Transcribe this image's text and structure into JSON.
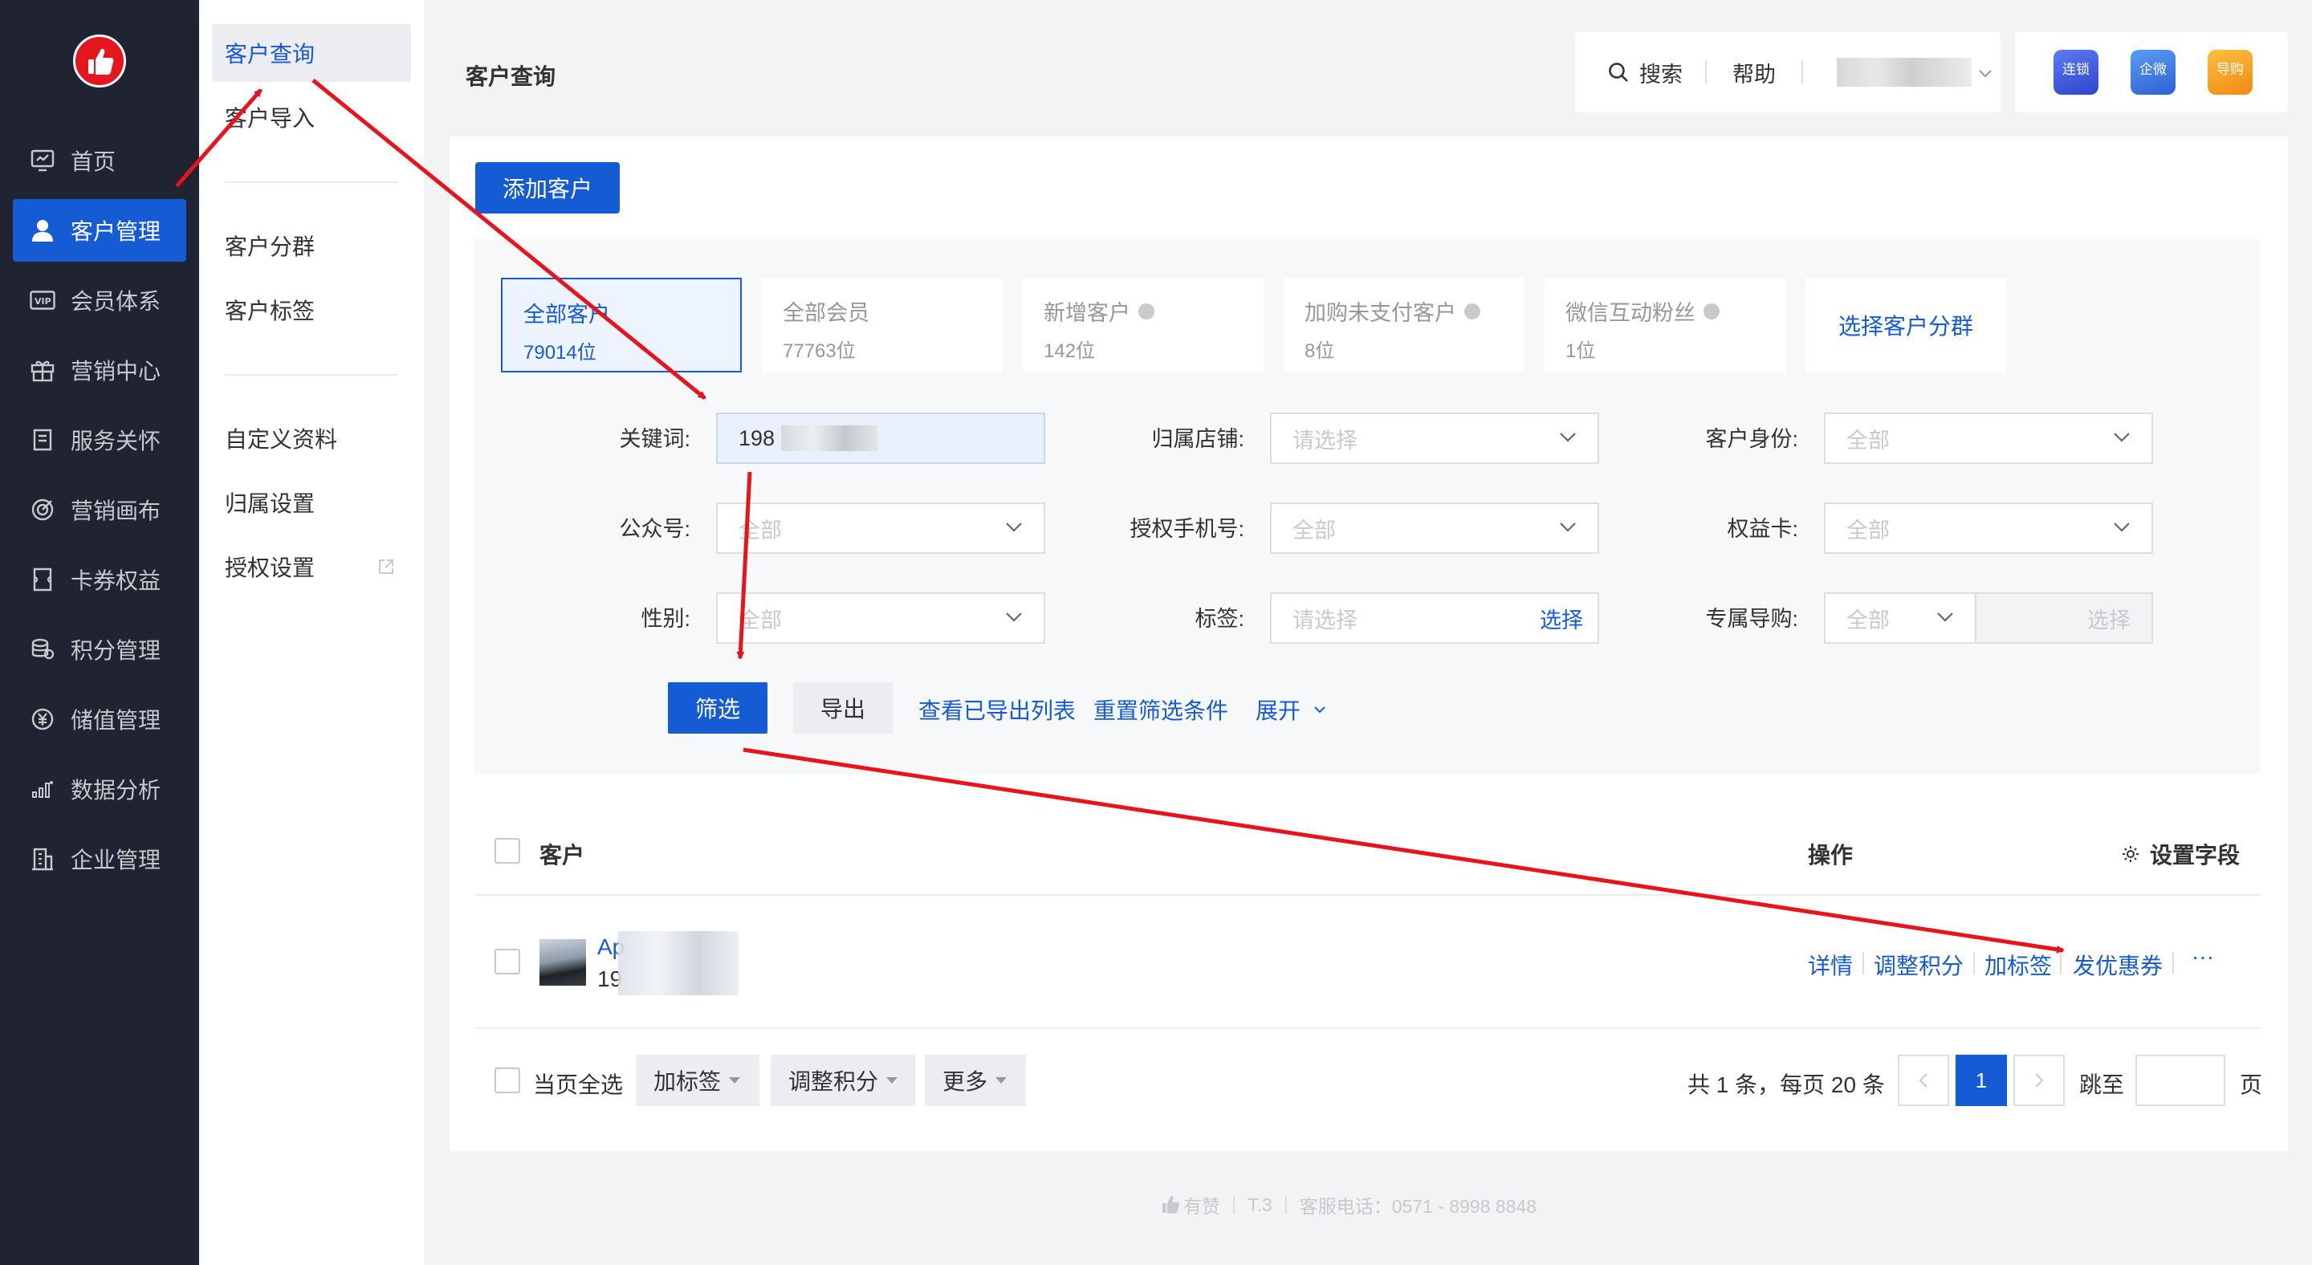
{
  "nav": {
    "items": [
      {
        "label": "首页",
        "icon": "dashboard-icon"
      },
      {
        "label": "客户管理",
        "icon": "user-icon"
      },
      {
        "label": "会员体系",
        "icon": "vip-icon"
      },
      {
        "label": "营销中心",
        "icon": "gift-icon"
      },
      {
        "label": "服务关怀",
        "icon": "book-icon"
      },
      {
        "label": "营销画布",
        "icon": "target-icon"
      },
      {
        "label": "卡券权益",
        "icon": "coupon-icon"
      },
      {
        "label": "积分管理",
        "icon": "coins-icon"
      },
      {
        "label": "储值管理",
        "icon": "yuan-icon"
      },
      {
        "label": "数据分析",
        "icon": "bar-chart-icon"
      },
      {
        "label": "企业管理",
        "icon": "building-icon"
      }
    ],
    "active_index": 1
  },
  "subnav": {
    "items": [
      "客户查询",
      "客户导入",
      "客户分群",
      "客户标签",
      "自定义资料",
      "归属设置",
      "授权设置"
    ],
    "active_index": 0
  },
  "header": {
    "page_title": "客户查询",
    "search_label": "搜索",
    "help_label": "帮助",
    "apps": [
      {
        "label": "连锁",
        "color": "#3b5bdb"
      },
      {
        "label": "企微",
        "color": "#3a7be0"
      },
      {
        "label": "导购",
        "color": "#f59a23"
      }
    ]
  },
  "toolbar": {
    "add_customer_label": "添加客户"
  },
  "segments": [
    {
      "title": "全部客户",
      "count": "79014位",
      "help": false
    },
    {
      "title": "全部会员",
      "count": "77763位",
      "help": false
    },
    {
      "title": "新增客户",
      "count": "142位",
      "help": true
    },
    {
      "title": "加购未支付客户",
      "count": "8位",
      "help": true
    },
    {
      "title": "微信互动粉丝",
      "count": "1位",
      "help": true
    }
  ],
  "segment_picker_label": "选择客户分群",
  "filters": {
    "keyword_label": "关键词:",
    "keyword_value": "198",
    "store_label": "归属店铺:",
    "store_placeholder": "请选择",
    "identity_label": "客户身份:",
    "identity_value": "全部",
    "official_label": "公众号:",
    "official_value": "全部",
    "phone_label": "授权手机号:",
    "phone_value": "全部",
    "benefit_label": "权益卡:",
    "benefit_value": "全部",
    "gender_label": "性别:",
    "gender_value": "全部",
    "tag_label": "标签:",
    "tag_placeholder": "请选择",
    "tag_select": "选择",
    "guide_label": "专属导购:",
    "guide_value": "全部",
    "guide_select": "选择"
  },
  "actions": {
    "filter": "筛选",
    "export": "导出",
    "view_exports": "查看已导出列表",
    "reset": "重置筛选条件",
    "expand": "展开"
  },
  "table": {
    "col_customer": "客户",
    "col_ops": "操作",
    "settings": "设置字段",
    "rows": [
      {
        "name_prefix": "Ap",
        "phone_prefix": "19",
        "ops": [
          "详情",
          "调整积分",
          "加标签",
          "发优惠券"
        ],
        "more": "···"
      }
    ]
  },
  "bulk": {
    "select_all": "当页全选",
    "buttons": [
      "加标签",
      "调整积分",
      "更多"
    ]
  },
  "pager": {
    "summary": "共 1 条，每页 20 条",
    "current": "1",
    "jump_label": "跳至",
    "page_unit": "页"
  },
  "footer": {
    "brand": "有赞",
    "version": "T.3",
    "service": "客服电话：0571 - 8998 8848"
  }
}
